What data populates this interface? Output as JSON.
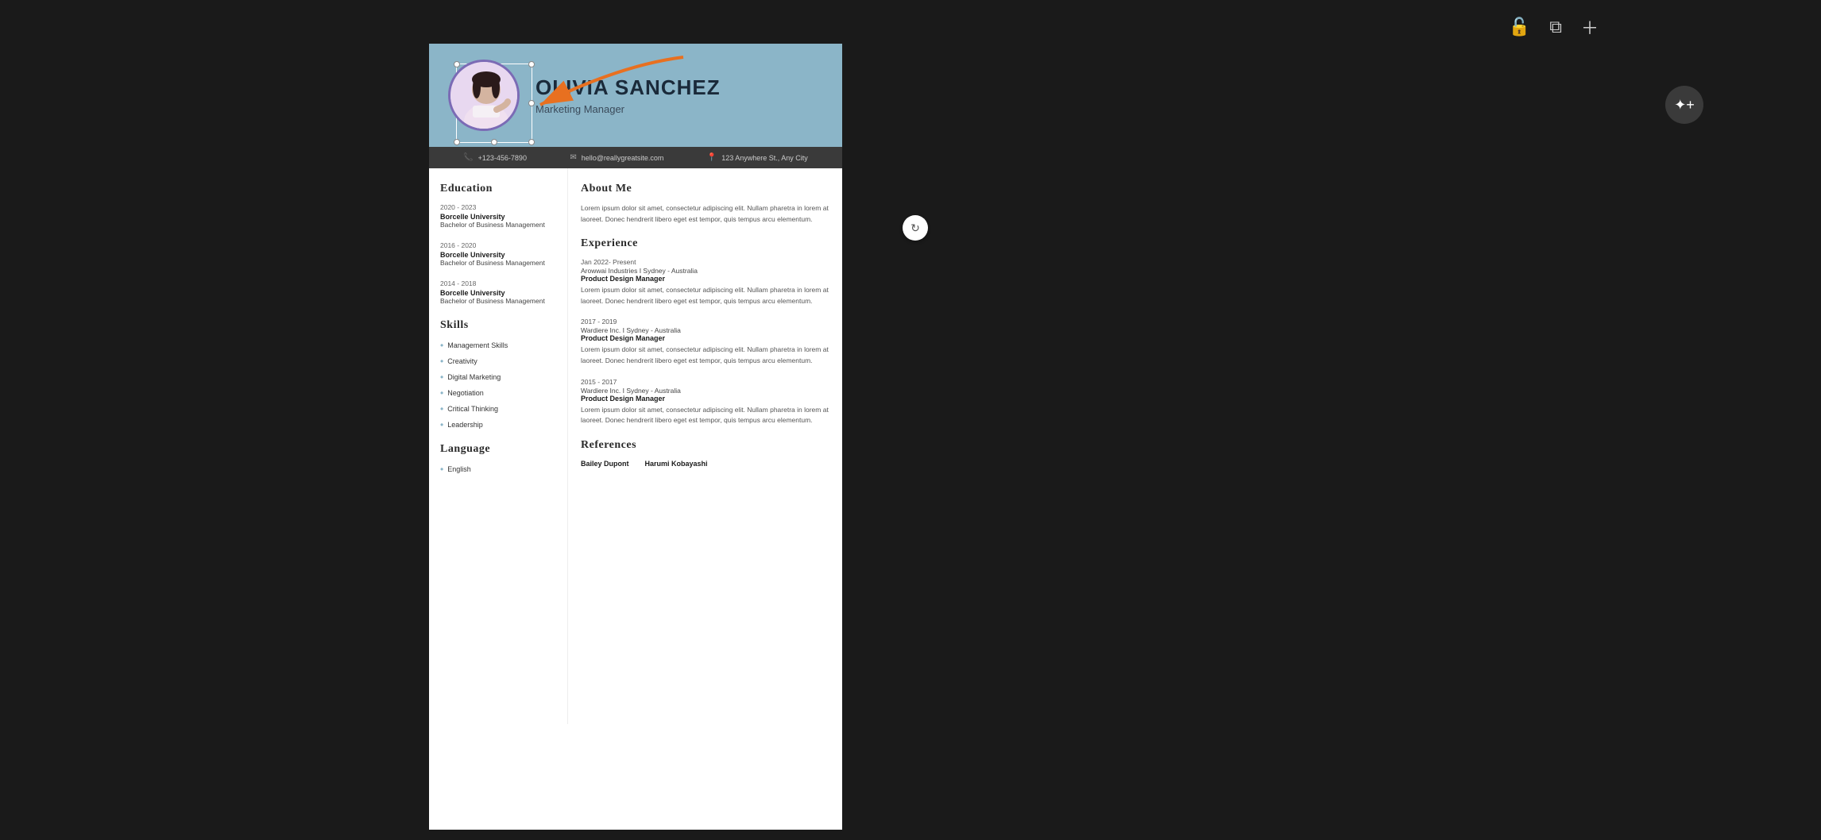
{
  "toolbar": {
    "unlock_icon": "🔓",
    "duplicate_icon": "⧉",
    "add_icon": "＋"
  },
  "fab": {
    "icon": "💬+"
  },
  "resume": {
    "header": {
      "name": "OLIVIA SANCHEZ",
      "title": "Marketing Manager",
      "photo_alt": "Profile photo"
    },
    "contact": {
      "phone": "+123-456-7890",
      "email": "hello@reallygreatsite.com",
      "address": "123 Anywhere St., Any City"
    },
    "education": {
      "section_title": "Education",
      "entries": [
        {
          "years": "2020 - 2023",
          "school": "Borcelle University",
          "degree": "Bachelor of Business Management"
        },
        {
          "years": "2016 - 2020",
          "school": "Borcelle University",
          "degree": "Bachelor of Business Management"
        },
        {
          "years": "2014 - 2018",
          "school": "Borcelle University",
          "degree": "Bachelor of Business Management"
        }
      ]
    },
    "skills": {
      "section_title": "Skills",
      "items": [
        "Management Skills",
        "Creativity",
        "Digital Marketing",
        "Negotiation",
        "Critical Thinking",
        "Leadership"
      ]
    },
    "language": {
      "section_title": "Language",
      "items": [
        "English"
      ]
    },
    "about": {
      "section_title": "About Me",
      "text": "Lorem ipsum dolor sit amet, consectetur adipiscing elit. Nullam pharetra in lorem at laoreet. Donec hendrerit libero eget est tempor, quis tempus arcu elementum."
    },
    "experience": {
      "section_title": "Experience",
      "entries": [
        {
          "period": "Jan 2022- Present",
          "company": "Arowwai Industries I Sydney - Australia",
          "role": "Product Design Manager",
          "text": "Lorem ipsum dolor sit amet, consectetur adipiscing elit. Nullam pharetra in lorem at laoreet. Donec hendrerit libero eget est tempor, quis tempus arcu elementum."
        },
        {
          "period": "2017 - 2019",
          "company": "Wardiere Inc. I Sydney - Australia",
          "role": "Product Design Manager",
          "text": "Lorem ipsum dolor sit amet, consectetur adipiscing elit. Nullam pharetra in lorem at laoreet. Donec hendrerit libero eget est tempor, quis tempus arcu elementum."
        },
        {
          "period": "2015 - 2017",
          "company": "Wardiere Inc. I Sydney - Australia",
          "role": "Product Design Manager",
          "text": "Lorem ipsum dolor sit amet, consectetur adipiscing elit. Nullam pharetra in lorem at laoreet. Donec hendrerit libero eget est tempor, quis tempus arcu elementum."
        }
      ]
    },
    "references": {
      "section_title": "References",
      "entries": [
        {
          "name": "Bailey Dupont"
        },
        {
          "name": "Harumi Kobayashi"
        }
      ]
    }
  }
}
